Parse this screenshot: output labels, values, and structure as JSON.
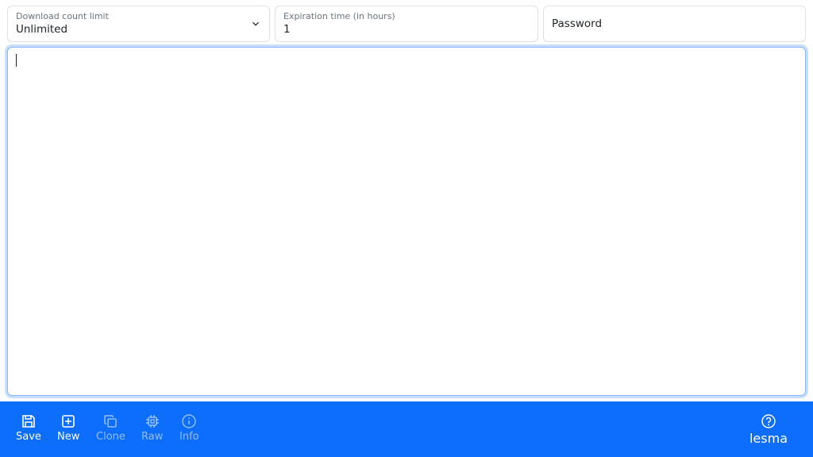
{
  "fields": {
    "download_limit": {
      "label": "Download count limit",
      "value": "Unlimited"
    },
    "expiration": {
      "label": "Expiration time (in hours)",
      "value": "1"
    },
    "password": {
      "placeholder": "Password"
    }
  },
  "editor": {
    "value": ""
  },
  "toolbar": {
    "save": "Save",
    "new": "New",
    "clone": "Clone",
    "raw": "Raw",
    "info": "Info",
    "brand": "lesma"
  },
  "colors": {
    "accent": "#0d6efd"
  }
}
